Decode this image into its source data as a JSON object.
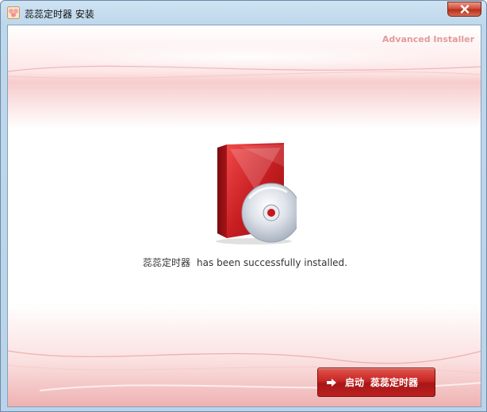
{
  "window": {
    "title": "蕊蕊定时器 安装",
    "app_icon": "app-flower-icon",
    "close_icon": "close-icon"
  },
  "brand": {
    "label": "Advanced Installer"
  },
  "main": {
    "product_name": "蕊蕊定时器",
    "status_message": "has been successfully installed.",
    "illustration": "software-box-cd-icon"
  },
  "footer": {
    "launch_verb": "启动",
    "launch_product": "蕊蕊定时器",
    "launch_icon": "arrow-right-icon"
  },
  "colors": {
    "accent_red": "#c82626",
    "brand_pink": "#e29a9a",
    "frame_blue": "#bdd7ec"
  }
}
